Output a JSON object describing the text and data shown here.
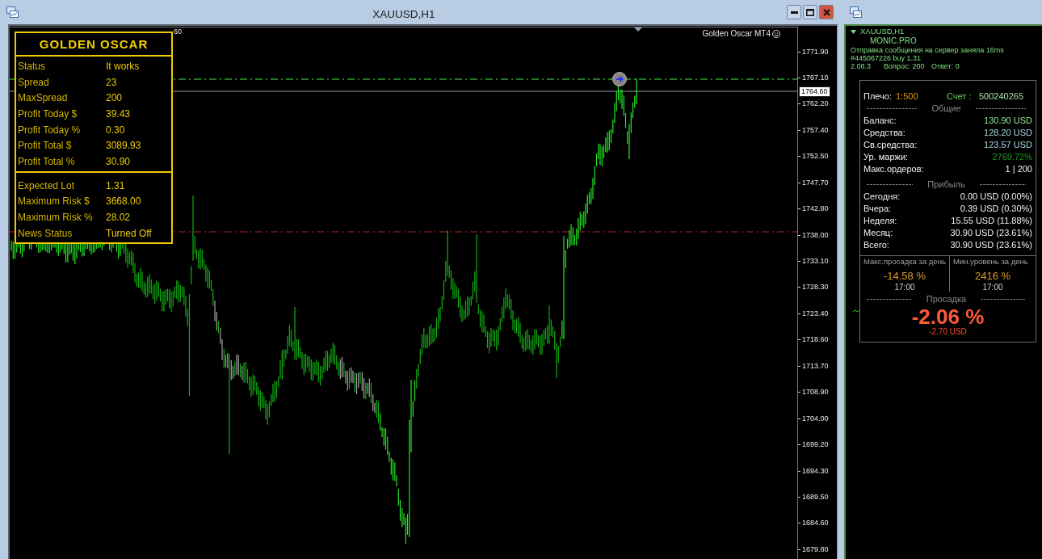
{
  "chart_window": {
    "title": "XAUUSD,H1"
  },
  "chart": {
    "info_fragment": "60",
    "indicator_label": "Golden Oscar MT4",
    "price_ticks": [
      "1771.90",
      "1767.10",
      "1762.20",
      "1757.40",
      "1752.50",
      "1747.70",
      "1742.80",
      "1738.00",
      "1733.10",
      "1728.30",
      "1723.40",
      "1718.60",
      "1713.70",
      "1708.90",
      "1704.00",
      "1699.20",
      "1694.30",
      "1689.50",
      "1684.60",
      "1679.80"
    ],
    "current_price": "1764.60"
  },
  "golden_oscar": {
    "title": "GOLDEN OSCAR",
    "groups": [
      [
        {
          "label": "Status",
          "value": "It works"
        },
        {
          "label": "Spread",
          "value": "23"
        },
        {
          "label": "MaxSpread",
          "value": "200"
        },
        {
          "label": "Profit Today $",
          "value": "39.43"
        },
        {
          "label": "Profit Today %",
          "value": "0.30"
        },
        {
          "label": "Profit Total $",
          "value": "3089.93"
        },
        {
          "label": "Profit Total %",
          "value": "30.90"
        }
      ],
      [
        {
          "label": "Expected Lot",
          "value": "1.31"
        },
        {
          "label": "Maximum Risk $",
          "value": "3668.00"
        },
        {
          "label": "Maximum Risk %",
          "value": "28.02"
        },
        {
          "label": "News Status",
          "value": "Turned Off"
        }
      ]
    ]
  },
  "terminal": {
    "symbol": "XAUUSD,H1",
    "brand": "MONIC.PRO",
    "log_lines": [
      "Отправка сообщения на сервер заняла 16ms",
      "#445067226 buy 1.31"
    ],
    "status": [
      "2.08.3",
      "Вопрос: 200",
      "Ответ: 0"
    ]
  },
  "account": {
    "leverage_label": "Плечо:",
    "leverage": "1:500",
    "number_label": "Счет :",
    "number": "500240265",
    "sections": [
      {
        "heading": "Общие",
        "rows": [
          {
            "label": "Баланс:",
            "value": "130.90 USD",
            "color": "#98e898"
          },
          {
            "label": "Средства:",
            "value": "128.20 USD",
            "color": "#a8d8dc"
          },
          {
            "label": "Св.средства:",
            "value": "123.57 USD",
            "color": "#a8d8e4"
          },
          {
            "label": "Ур. маржи:",
            "value": "2769.72%",
            "color": "#1c9c1c"
          },
          {
            "label": "Макс.ордеров:",
            "value": "1 | 200"
          }
        ]
      },
      {
        "heading": "Прибыль",
        "rows": [
          {
            "label": "Сегодня:",
            "value": "0.00 USD (0.00%)"
          },
          {
            "label": "Вчера:",
            "value": "0.39 USD (0.30%)"
          },
          {
            "label": "Неделя:",
            "value": "15.55 USD (11.88%)"
          },
          {
            "label": "Месяц:",
            "value": "30.90 USD (23.61%)"
          },
          {
            "label": "Всего:",
            "value": "30.90 USD (23.61%)"
          }
        ]
      }
    ],
    "daily": [
      {
        "label": "Макс.просадка за день",
        "value": "-14.58 %",
        "time": "17:00"
      },
      {
        "label": "Мин.уровень за день",
        "value": "2416 %",
        "time": "17:00"
      }
    ],
    "drawdown": {
      "heading": "Просадка",
      "percent": "-2.06 %",
      "amount": "-2.70 USD"
    }
  }
}
